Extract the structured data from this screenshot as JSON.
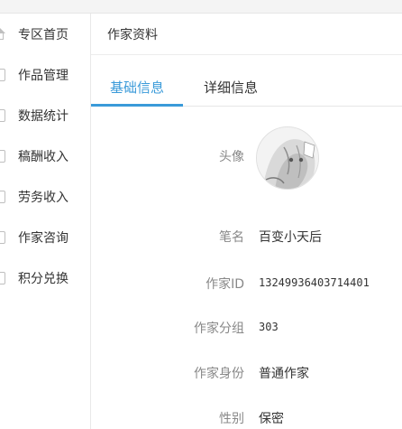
{
  "sidebar": {
    "items": [
      {
        "label": "专区首页",
        "icon": "home-icon"
      },
      {
        "label": "作品管理",
        "icon": "document-icon"
      },
      {
        "label": "数据统计",
        "icon": "chart-icon"
      },
      {
        "label": "稿酬收入",
        "icon": "wallet-icon"
      },
      {
        "label": "劳务收入",
        "icon": "coin-icon"
      },
      {
        "label": "作家咨询",
        "icon": "chat-icon"
      },
      {
        "label": "积分兑换",
        "icon": "gift-icon"
      }
    ]
  },
  "page": {
    "title": "作家资料"
  },
  "tabs": [
    {
      "label": "基础信息",
      "active": true
    },
    {
      "label": "详细信息",
      "active": false
    }
  ],
  "profile": {
    "avatar_label": "头像",
    "pen_name_label": "笔名",
    "pen_name": "百变小天后",
    "writer_id_label": "作家ID",
    "writer_id": "13249936403714401",
    "group_label": "作家分组",
    "group": "303",
    "identity_label": "作家身份",
    "identity": "普通作家",
    "gender_label": "性别",
    "gender": "保密"
  },
  "colors": {
    "accent": "#3a9ad9",
    "label_gray": "#888888",
    "text": "#333333"
  }
}
